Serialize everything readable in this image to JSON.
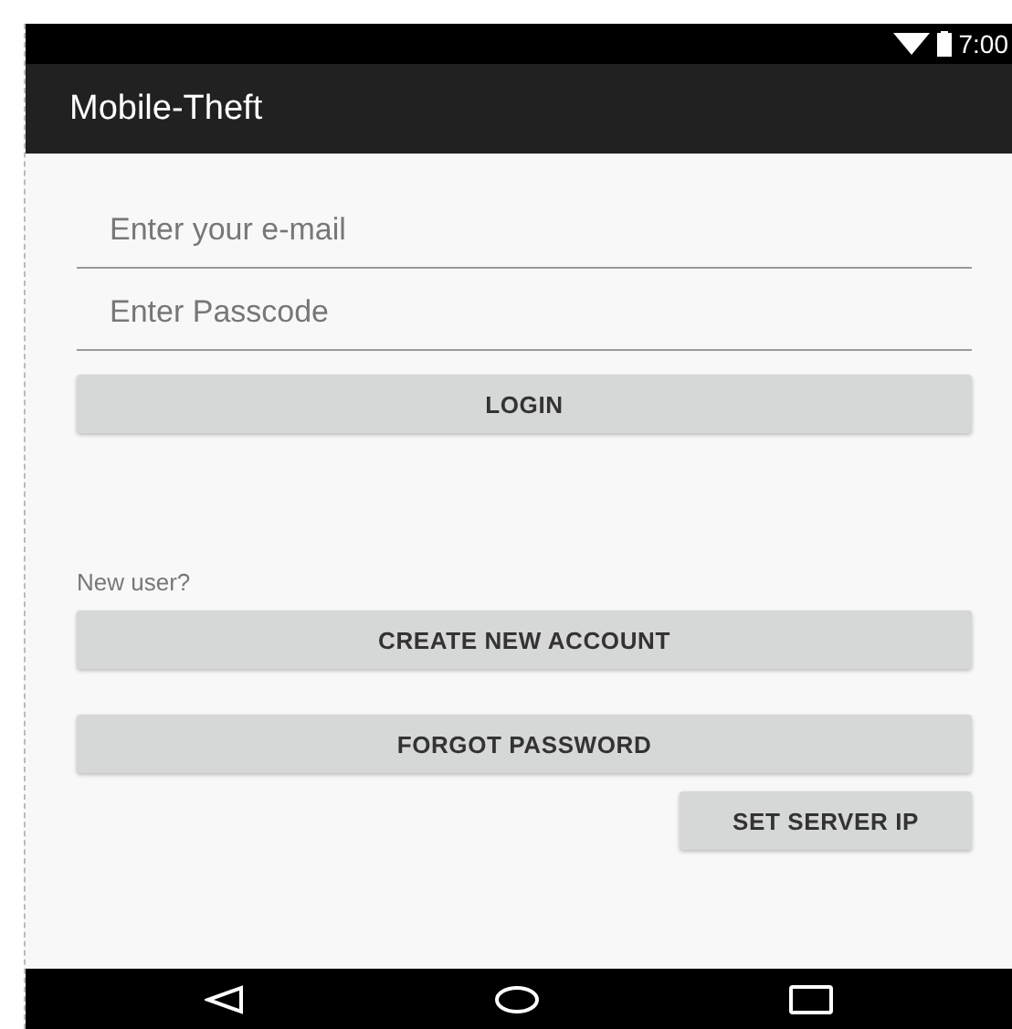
{
  "status_bar": {
    "time": "7:00"
  },
  "app_bar": {
    "title": "Mobile-Theft"
  },
  "fields": [
    {
      "placeholder": "Enter your e-mail"
    },
    {
      "placeholder": "Enter Passcode"
    }
  ],
  "login_button": "LOGIN",
  "new_user_label": "New user?",
  "buttons": [
    {
      "label": "CREATE NEW ACCOUNT",
      "kind": "wide"
    },
    {
      "label": "FORGOT PASSWORD",
      "kind": "wide"
    },
    {
      "label": "SET SERVER IP",
      "kind": "small"
    }
  ]
}
